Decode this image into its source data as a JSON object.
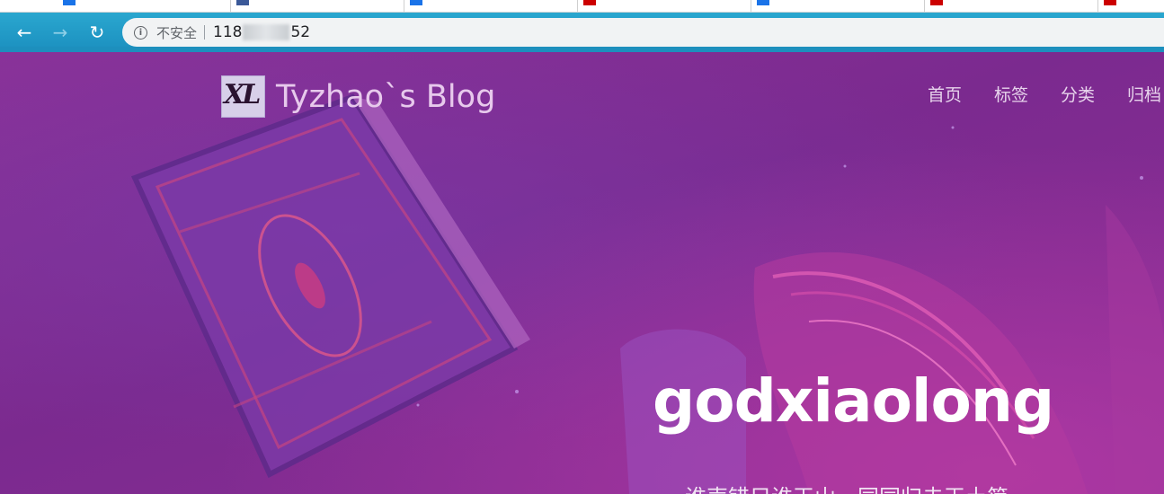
{
  "browser": {
    "tab_favicon_colors": [
      "#1a73e8",
      "#3b5998",
      "#1a73e8",
      "#cc0000",
      "#1a73e8",
      "#cc0000",
      "#cc0000",
      "#1a73e8",
      "#111111"
    ],
    "toolbar": {
      "back_icon": "←",
      "forward_icon": "→",
      "reload_icon": "↻"
    },
    "address_bar": {
      "info_icon": "i",
      "security_label": "不安全",
      "url_prefix": "118",
      "url_suffix": "52",
      "url_partially_redacted": true
    }
  },
  "site": {
    "title": "Tyzhao`s Blog",
    "logo_mark": "XL",
    "nav": [
      "首页",
      "标签",
      "分类",
      "归档"
    ]
  },
  "hero": {
    "title": "godxiaolong",
    "subtitle": "谁声错只谁王山，同同归击王土简"
  },
  "colors": {
    "toolbar": "#1b8fbf",
    "page_background": "#7b2a8f",
    "hero_title": "#ffffff"
  }
}
